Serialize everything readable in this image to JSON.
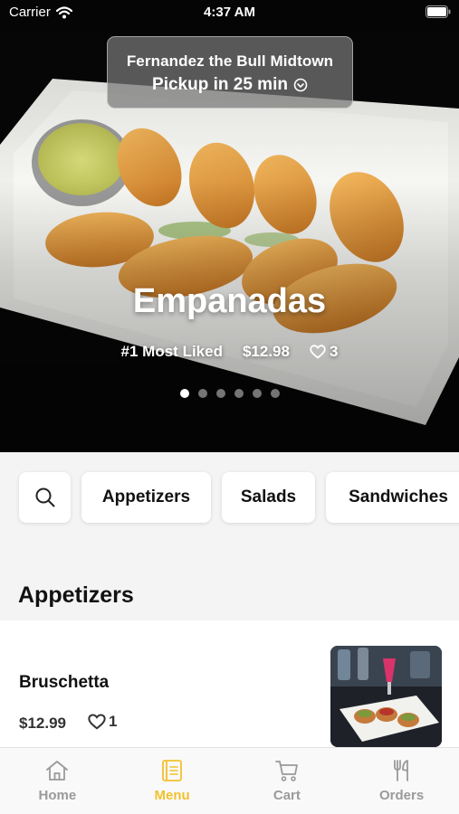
{
  "status_bar": {
    "carrier": "Carrier",
    "time": "4:37 AM"
  },
  "store": {
    "name": "Fernandez the Bull Midtown",
    "pickup": "Pickup in 25 min",
    "icon": "chevron-down-circle-icon"
  },
  "hero": {
    "title": "Empanadas",
    "badge": "#1 Most Liked",
    "price": "$12.98",
    "likes": "3",
    "slide_count": 6,
    "active_slide": 1
  },
  "categories": {
    "search_icon": "search-icon",
    "items": [
      "Appetizers",
      "Salads",
      "Sandwiches"
    ]
  },
  "section": {
    "title": "Appetizers"
  },
  "menu_items": [
    {
      "name": "Bruschetta",
      "price": "$12.99",
      "likes": "1"
    }
  ],
  "tabs": [
    {
      "label": "Home",
      "icon": "home-icon",
      "active": false
    },
    {
      "label": "Menu",
      "icon": "menu-icon",
      "active": true
    },
    {
      "label": "Cart",
      "icon": "cart-icon",
      "active": false
    },
    {
      "label": "Orders",
      "icon": "orders-icon",
      "active": false
    }
  ],
  "colors": {
    "accent": "#f2c12e",
    "inactive_tab": "#9a9a9a",
    "background": "#f4f4f4"
  }
}
